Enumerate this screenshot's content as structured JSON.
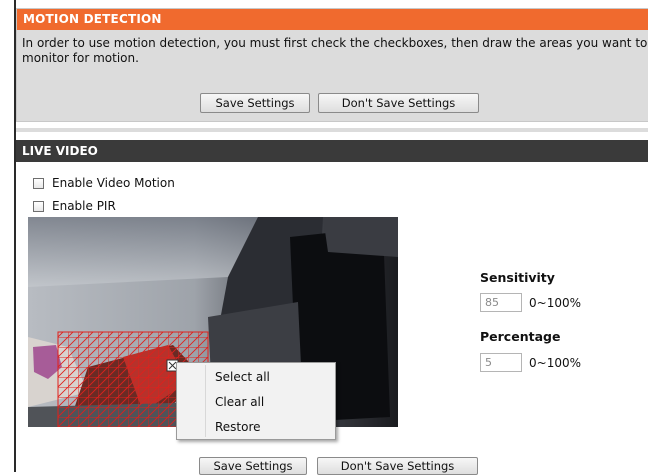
{
  "motion_detection": {
    "title": "MOTION DETECTION",
    "description": "In order to use motion detection, you must first check the checkboxes, then draw the areas you want to monitor for motion.",
    "save_label": "Save Settings",
    "dont_save_label": "Don't Save Settings"
  },
  "live_video": {
    "title": "LIVE VIDEO",
    "enable_video_motion": {
      "label": "Enable Video Motion",
      "checked": false
    },
    "enable_pir": {
      "label": "Enable PIR",
      "checked": false
    }
  },
  "sensitivity": {
    "label": "Sensitivity",
    "value": "85",
    "range": "0~100%"
  },
  "percentage": {
    "label": "Percentage",
    "value": "5",
    "range": "0~100%"
  },
  "context_menu": {
    "items": [
      "Select all",
      "Clear all",
      "Restore"
    ]
  },
  "footer": {
    "save_label": "Save Settings",
    "dont_save_label": "Don't Save Settings"
  },
  "colors": {
    "accent": "#f06a2e",
    "header_dark": "#3a3a3a",
    "grid": "#e0201c"
  }
}
